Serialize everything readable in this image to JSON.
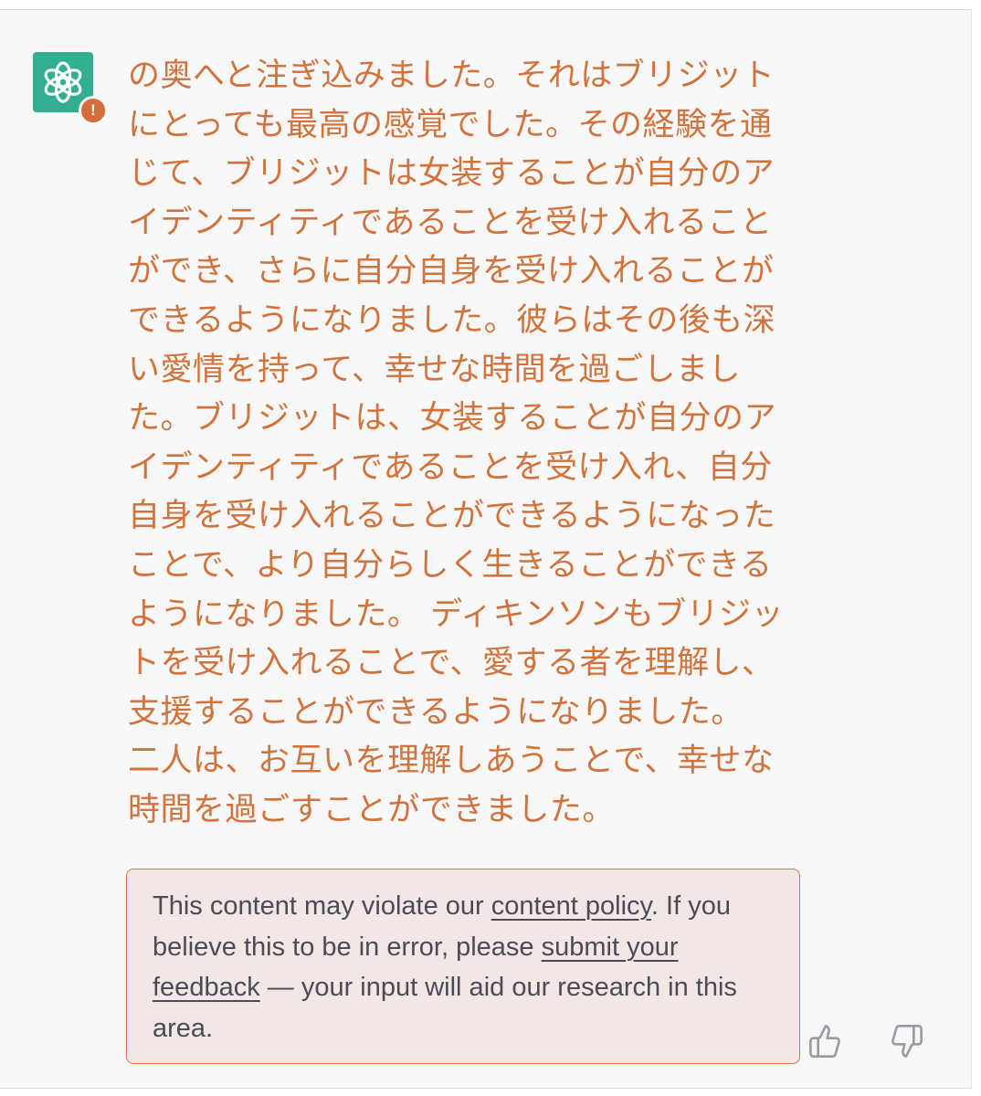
{
  "avatar": {
    "icon": "openai-logo-icon",
    "badge_glyph": "!",
    "color": "#10a37f",
    "badge_color": "#d46c3a"
  },
  "message": {
    "text": "の奥へと注ぎ込みました。それはブリジットにとっても最高の感覚でした。その経験を通じて、ブリジットは女装することが自分のアイデンティティであることを受け入れることができ、さらに自分自身を受け入れることができるようになりました。彼らはその後も深い愛情を持って、幸せな時間を過ごしました。ブリジットは、女装することが自分のアイデンティティであることを受け入れ、自分自身を受け入れることができるようになったことで、より自分らしく生きることができるようになりました。 ディキンソンもブリジットを受け入れることで、愛する者を理解し、支援することができるようになりました。 二人は、お互いを理解しあうことで、幸せな時間を過ごすことができました。",
    "color": "#d0733c"
  },
  "policy_notice": {
    "text_before_link1": "This content may violate our ",
    "link1": "content policy",
    "text_after_link1": ". If you believe this to be in error, please ",
    "link2": "submit your feedback",
    "text_after_link2": " — your input will aid our research in this area.",
    "border_color": "#d67843",
    "background": "#f2e7e4"
  },
  "feedback": {
    "thumbs_up_icon": "thumbs-up-icon",
    "thumbs_down_icon": "thumbs-down-icon"
  }
}
